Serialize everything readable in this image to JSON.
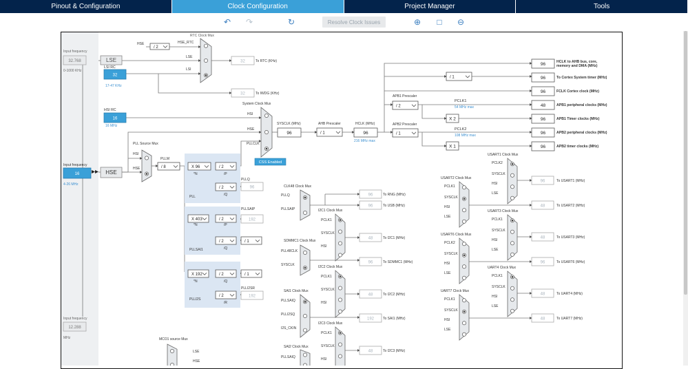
{
  "tabs": [
    {
      "label": "Pinout & Configuration",
      "active": false
    },
    {
      "label": "Clock Configuration",
      "active": true
    },
    {
      "label": "Project Manager",
      "active": false
    },
    {
      "label": "Tools",
      "active": false
    }
  ],
  "toolbar": {
    "resolve_label": "Resolve Clock Issues"
  },
  "left": {
    "input_freq_label": "Input frequency",
    "input_freq_value": "32.768",
    "input_freq_range": "0-1000 KHz",
    "lse_label": "LSE",
    "lsi_rc_label": "LSI RC",
    "lsi_value": "32",
    "lsi_khz": "17-47 KHz",
    "hsi_rc_label": "HSI RC",
    "hsi_value": "16",
    "hsi_mhz": "16 MHz",
    "hse_input_label": "Input frequency",
    "hse_input_value": "16",
    "hse_range": "4-26 MHz",
    "hse_label": "HSE",
    "in3_label": "Input frequency",
    "in3_value": "12.288",
    "in3_unit": "MHz"
  },
  "rtc": {
    "mux_label": "RTC Clock Mux",
    "hse_label": "HSE",
    "div_label": "/ 2",
    "hse_rtc": "HSE_RTC",
    "lse": "LSE",
    "lsi": "LSI",
    "rtc_value": "32",
    "rtc_out": "To RTC (KHz)",
    "iwdg_value": "32",
    "iwdg_out": "To IWDG (KHz)"
  },
  "sys": {
    "mux_label": "System Clock Mux",
    "hsi": "HSI",
    "hse": "HSE",
    "pllclk": "PLLCLK",
    "css_label": "CSS Enabled",
    "sysclk_label": "SYSCLK (MHz)",
    "sysclk_value": "96",
    "ahb_label": "AHB Prescaler",
    "ahb_value": "/ 1",
    "hclk_label": "HCLK (MHz)",
    "hclk_value": "96",
    "hclk_max": "216 MHz max",
    "apb1_label": "APB1 Prescaler",
    "apb1_value": "/ 2",
    "pclk1": "PCLK1",
    "pclk1_max": "54 MHz max",
    "x2": "X 2",
    "apb2_label": "APB2 Prescaler",
    "apb2_value": "/ 1",
    "pclk2": "PCLK2",
    "pclk2_max": "108 MHz max",
    "x1": "X 1",
    "cortex_div": "/ 1"
  },
  "outputs": [
    {
      "value": "96",
      "label": "HCLK to AHB bus, core,",
      "label2": "memory and DMA (MHz)"
    },
    {
      "value": "96",
      "label": "To Cortex System timer (MHz)"
    },
    {
      "value": "96",
      "label": "FCLK Cortex clock (MHz)"
    },
    {
      "value": "48",
      "label": "APB1 peripheral clocks (MHz)"
    },
    {
      "value": "96",
      "label": "APB1 Timer clocks (MHz)"
    },
    {
      "value": "96",
      "label": "APB2 peripheral clocks (MHz)"
    },
    {
      "value": "96",
      "label": "APB2 timer clocks (MHz)"
    }
  ],
  "pll": {
    "source_mux": "PLL Source Mux",
    "hsi": "HSI",
    "hse": "HSE",
    "pllm": "PLLM",
    "pllm_value": "/ 8",
    "main_n": "X 96",
    "main_p": "/ 2",
    "main_q": "/ 2",
    "pll_label": "PLL",
    "p_lbl": "/P",
    "q_lbl": "/Q",
    "n_lbl": "*N",
    "pllq": "PLLQ",
    "pllq_value": "96",
    "sai_n": "X 403",
    "sai_p": "/ 2",
    "sai_q": "/ 2",
    "sai_r": "/ 1",
    "sai_label": "PLLSAI1",
    "pllsaip": "PLLSAIP",
    "pllsaip_value": "192",
    "r_lbl": "/R",
    "i2s_n": "X 192",
    "i2s_q": "/ 2",
    "i2s_r": "/ 2",
    "i2s_d": "/ 1",
    "i2s_label": "PLLI2S",
    "plli2sr": "PLLI2SR",
    "plli2sr_value": "192"
  },
  "clk48": {
    "mux_label": "CLK48 Clock Mux",
    "pllq": "PLLQ",
    "pllsaip": "PLLSAIP",
    "rng_value": "96",
    "rng_label": "To RNG (MHz)",
    "usb_value": "96",
    "usb_label": "To USB (MHz)"
  },
  "sdmmc": {
    "mux_label": "SDMMC1 Clock Mux",
    "in1": "PLL48CLK",
    "in2": "SYSCLK",
    "value": "96",
    "label": "To SDMMC1 (MHz)"
  },
  "sai1": {
    "mux_label": "SAI1 Clock Mux",
    "in1": "PLLSAIQ",
    "in2": "PLLI2SQ",
    "in3": "I2S_CKIN",
    "value": "192",
    "label": "To SAI1 (MHz)"
  },
  "sai2": {
    "mux_label": "SAI2 Clock Mux",
    "in1": "PLLSAIQ"
  },
  "i2c": [
    {
      "mux_label": "I2C1 Clock Mux",
      "value": "48",
      "label": "To I2C1 (MHz)"
    },
    {
      "mux_label": "I2C2 Clock Mux",
      "value": "48",
      "label": "To I2C2 (MHz)"
    },
    {
      "mux_label": "I2C3 Clock Mux",
      "value": "48",
      "label": "To I2C3 (MHz)"
    }
  ],
  "mux_inputs": {
    "pclk1": "PCLK1",
    "pclk2": "PCLK2",
    "sysclk": "SYSCLK",
    "hsi": "HSI",
    "lse": "LSE"
  },
  "usart_left": [
    {
      "mux_label": "USART2 Clock Mux",
      "value": "48",
      "label": "To USART2 (MHz)"
    },
    {
      "mux_label": "USART6 Clock Mux",
      "value": "96",
      "label": "To USART6 (MHz)"
    },
    {
      "mux_label": "UART7 Clock Mux",
      "value": "48",
      "label": "To UART7 (MHz)"
    }
  ],
  "usart_right": [
    {
      "mux_label": "USART1 Clock Mux",
      "value": "96",
      "label": "To USART1 (MHz)"
    },
    {
      "mux_label": "USART3 Clock Mux",
      "value": "48",
      "label": "To USART3 (MHz)"
    },
    {
      "mux_label": "UART4 Clock Mux",
      "value": "48",
      "label": "To UART4 (MHz)"
    }
  ],
  "mco1": {
    "mux_label": "MCO1 source Mux",
    "lse": "LSE",
    "hse": "HSE"
  }
}
